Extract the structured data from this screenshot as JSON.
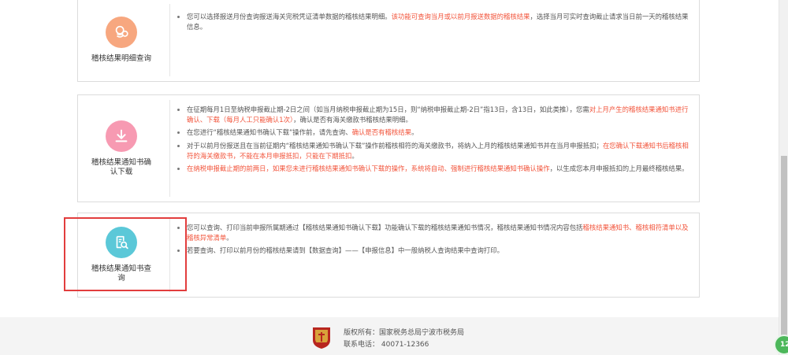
{
  "colors": {
    "orange": "#f7a77f",
    "pink": "#f79ab2",
    "teal": "#5bc8d8",
    "red_text": "#f2543b",
    "highlight": "#e23d3d"
  },
  "cards": [
    {
      "title": "稽核结果明细查询",
      "icon": "coin-stack-icon",
      "items": [
        {
          "segments": [
            {
              "t": "您可以选择报送月份查询报送海关完税凭证清单数据的稽核结果明细。",
              "red": false
            },
            {
              "t": "该功能可查询当月或以前月报送数据的稽核结果",
              "red": true
            },
            {
              "t": "，选择当月可实时查询截止请求当日前一天的稽核结果信息。",
              "red": false
            }
          ]
        }
      ]
    },
    {
      "title": "稽核结果通知书确认下载",
      "icon": "download-icon",
      "items": [
        {
          "segments": [
            {
              "t": "在征期每月1日至纳税申报截止期-2日之间（如当月纳税申报截止期为15日，则“纳税申报截止期-2日”指13日，含13日，如此类推），您需",
              "red": false
            },
            {
              "t": "对上月产生的稽核结果通知书进行确认、下载（每月人工只能确认1次）",
              "red": true
            },
            {
              "t": "，确认是否有海关缴款书稽核结果明细。",
              "red": false
            }
          ]
        },
        {
          "segments": [
            {
              "t": "在您进行“稽核结果通知书确认下载”操作前，请先查询、",
              "red": false
            },
            {
              "t": "确认是否有稽核结果",
              "red": true
            },
            {
              "t": "。",
              "red": false
            }
          ]
        },
        {
          "segments": [
            {
              "t": "对于以前月份报送且在当前征期内“稽核结果通知书确认下载”操作前稽核相符的海关缴款书，将纳入上月的稽核结果通知书并在当月申报抵扣；",
              "red": false
            },
            {
              "t": "在您确认下载通知书后稽核相符的海关缴款书，不能在本月申报抵扣，只能在下期抵扣",
              "red": true
            },
            {
              "t": "。",
              "red": false
            }
          ]
        },
        {
          "segments": [
            {
              "t": "在纳税申报截止期的前两日，如果您未进行稽核结果通知书确认下载的操作，系统将自动、强制进行稽核结果通知书确认操作",
              "red": true
            },
            {
              "t": "，以生成您本月申报抵扣的上月最终稽核结果。",
              "red": false
            }
          ]
        }
      ]
    },
    {
      "title": "稽核结果通知书查询",
      "icon": "document-search-icon",
      "items": [
        {
          "segments": [
            {
              "t": "您可以查询、打印当前申报所属期通过【稽核结果通知书确认下载】功能确认下载的稽核结果通知书情况，稽核结果通知书情况内容包括",
              "red": false
            },
            {
              "t": "稽核结果通知书、稽核相符清单以及稽核异常清单",
              "red": true
            },
            {
              "t": "。",
              "red": false
            }
          ]
        },
        {
          "segments": [
            {
              "t": "若要查询、打印以前月份的稽核结果请到【数据查询】——【申报信息】中一般纳税人查询结果中查询打印。",
              "red": false
            }
          ]
        }
      ]
    }
  ],
  "footer": {
    "copyright": "版权所有：国家税务总局宁波市税务局",
    "phone": "联系电话：  40071-12366"
  },
  "badge": {
    "text": "12"
  }
}
